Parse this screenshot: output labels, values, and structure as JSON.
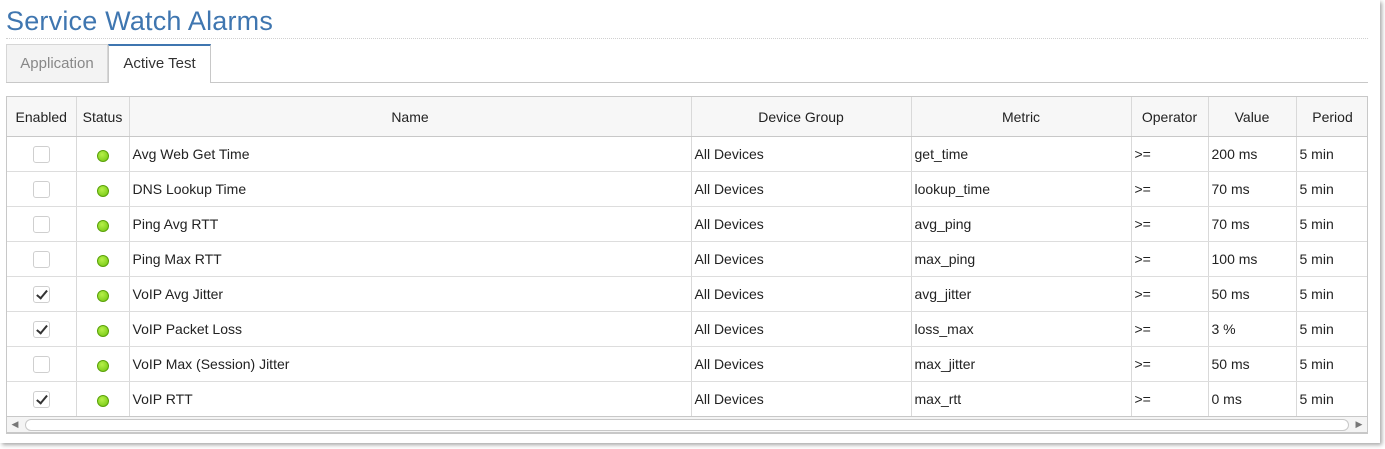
{
  "page": {
    "title": "Service Watch Alarms"
  },
  "tabs": [
    {
      "label": "Application",
      "active": false
    },
    {
      "label": "Active Test",
      "active": true
    }
  ],
  "table": {
    "columns": [
      "Enabled",
      "Status",
      "Name",
      "Device Group",
      "Metric",
      "Operator",
      "Value",
      "Period"
    ],
    "rows": [
      {
        "enabled": false,
        "status": "green",
        "name": "Avg Web Get Time",
        "device_group": "All Devices",
        "metric": "get_time",
        "operator": ">=",
        "value": "200 ms",
        "period": "5 min"
      },
      {
        "enabled": false,
        "status": "green",
        "name": "DNS Lookup Time",
        "device_group": "All Devices",
        "metric": "lookup_time",
        "operator": ">=",
        "value": "70 ms",
        "period": "5 min"
      },
      {
        "enabled": false,
        "status": "green",
        "name": "Ping Avg RTT",
        "device_group": "All Devices",
        "metric": "avg_ping",
        "operator": ">=",
        "value": "70 ms",
        "period": "5 min"
      },
      {
        "enabled": false,
        "status": "green",
        "name": "Ping Max RTT",
        "device_group": "All Devices",
        "metric": "max_ping",
        "operator": ">=",
        "value": "100 ms",
        "period": "5 min"
      },
      {
        "enabled": true,
        "status": "green",
        "name": "VoIP Avg Jitter",
        "device_group": "All Devices",
        "metric": "avg_jitter",
        "operator": ">=",
        "value": "50 ms",
        "period": "5 min"
      },
      {
        "enabled": true,
        "status": "green",
        "name": "VoIP Packet Loss",
        "device_group": "All Devices",
        "metric": "loss_max",
        "operator": ">=",
        "value": "3 %",
        "period": "5 min"
      },
      {
        "enabled": false,
        "status": "green",
        "name": "VoIP Max (Session) Jitter",
        "device_group": "All Devices",
        "metric": "max_jitter",
        "operator": ">=",
        "value": "50 ms",
        "period": "5 min"
      },
      {
        "enabled": true,
        "status": "green",
        "name": "VoIP RTT",
        "device_group": "All Devices",
        "metric": "max_rtt",
        "operator": ">=",
        "value": "0 ms",
        "period": "5 min"
      }
    ]
  },
  "colors": {
    "accent": "#3f76b0",
    "status_green": "#7ccc1a"
  },
  "icons": {
    "scroll_left": "triangle-left-icon",
    "scroll_right": "triangle-right-icon"
  }
}
